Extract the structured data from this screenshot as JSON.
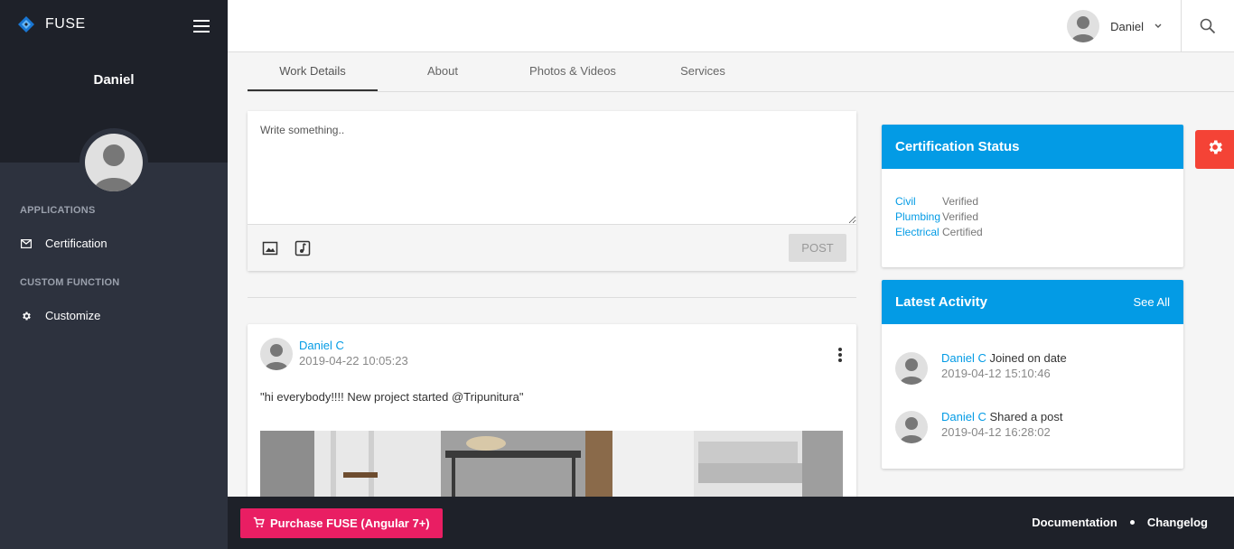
{
  "brand": {
    "name": "FUSE"
  },
  "sidebar": {
    "user_name": "Daniel",
    "sections": [
      {
        "title": "APPLICATIONS",
        "items": [
          {
            "label": "Certification",
            "icon": "mail-icon"
          }
        ]
      },
      {
        "title": "CUSTOM FUNCTION",
        "items": [
          {
            "label": "Customize",
            "icon": "gear-icon"
          }
        ]
      }
    ]
  },
  "topbar": {
    "user_name": "Daniel"
  },
  "tabs": [
    {
      "label": "Work Details",
      "active": true
    },
    {
      "label": "About",
      "active": false
    },
    {
      "label": "Photos & Videos",
      "active": false
    },
    {
      "label": "Services",
      "active": false
    }
  ],
  "composer": {
    "placeholder": "Write something..",
    "post_label": "POST"
  },
  "post": {
    "author": "Daniel C",
    "time": "2019-04-22 10:05:23",
    "text": "\"hi everybody!!!! New project started @Tripunitura\""
  },
  "certification": {
    "title": "Certification Status",
    "rows": [
      {
        "name": "Civil",
        "status": "Verified"
      },
      {
        "name": "Plumbing",
        "status": "Verified"
      },
      {
        "name": "Electrical",
        "status": "Certified"
      }
    ]
  },
  "activity": {
    "title": "Latest Activity",
    "see_all": "See All",
    "items": [
      {
        "name": "Daniel C",
        "action": "Joined on date",
        "time": "2019-04-12 15:10:46"
      },
      {
        "name": "Daniel C",
        "action": "Shared a post",
        "time": "2019-04-12 16:28:02"
      }
    ]
  },
  "footer": {
    "purchase_label": "Purchase FUSE (Angular 7+)",
    "links": [
      "Documentation",
      "Changelog"
    ]
  },
  "colors": {
    "accent": "#039be5",
    "danger": "#f44336",
    "pink": "#e91e63",
    "sidebar": "#2d323e",
    "sidebar_top": "#1e2129"
  }
}
